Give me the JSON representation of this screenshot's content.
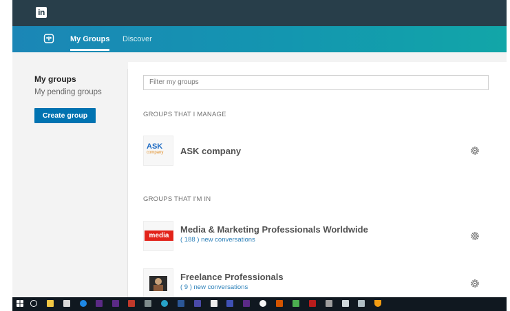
{
  "topbar": {
    "logo_text": "in"
  },
  "nav": {
    "groups_icon": "groups-icon",
    "tabs": [
      {
        "label": "My Groups",
        "active": true
      },
      {
        "label": "Discover",
        "active": false
      }
    ]
  },
  "sidebar": {
    "title": "My groups",
    "pending": "My pending groups",
    "create_button": "Create group"
  },
  "main": {
    "filter_placeholder": "Filter my groups",
    "manage_header": "GROUPS THAT I MANAGE",
    "member_header": "GROUPS THAT I'M IN",
    "managed_groups": [
      {
        "name": "ASK company",
        "logo_text": "ASK",
        "logo_sub": "company",
        "logo_icon": "ask-company-logo"
      }
    ],
    "member_groups": [
      {
        "name": "Media & Marketing Professionals Worldwide",
        "conversations": "( 188 ) new conversations",
        "logo_text": "media",
        "logo_icon": "media-logo"
      },
      {
        "name": "Freelance Professionals",
        "conversations": "( 9 ) new conversations",
        "logo_icon": "freelance-logo"
      }
    ]
  },
  "colors": {
    "topbar": "#283e4a",
    "subnav_start": "#1b86b6",
    "subnav_end": "#12a6a8",
    "primary_button": "#0073b1",
    "link": "#2a7fb8",
    "media_red": "#e2231a"
  },
  "taskbar": {
    "icons": [
      "windows-start-icon",
      "search-circle-icon",
      "file-explorer-icon",
      "store-icon",
      "edge-icon",
      "app-icon",
      "app-icon",
      "app-icon",
      "app-icon",
      "app-icon",
      "app-icon",
      "app-icon",
      "app-icon",
      "app-icon",
      "app-icon",
      "app-icon",
      "app-icon",
      "app-icon",
      "app-icon",
      "app-icon",
      "app-icon",
      "app-icon",
      "app-icon",
      "app-icon"
    ]
  }
}
